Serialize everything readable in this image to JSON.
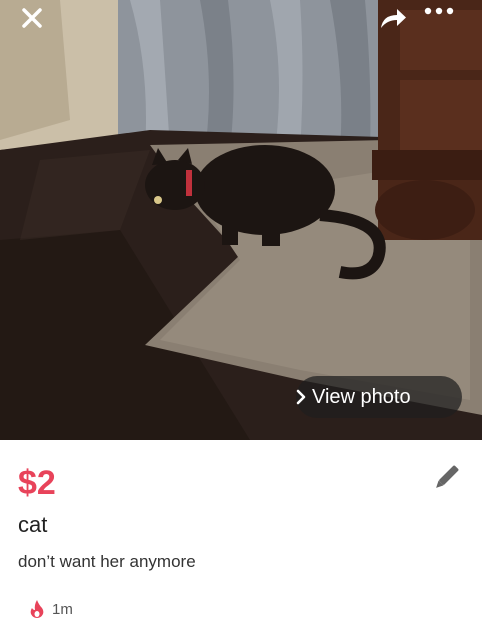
{
  "header": {
    "close_icon": "close-icon",
    "share_icon": "share-icon",
    "more_icon": "more-dots-icon"
  },
  "photo": {
    "view_photo_label": "View photo",
    "view_photo_icon": "chevron-right-icon"
  },
  "listing": {
    "price": "$2",
    "title": "cat",
    "description": "don’t want her anymore",
    "age": "1m",
    "age_icon": "flame-icon",
    "edit_icon": "pencil-icon"
  },
  "colors": {
    "price": "#e8435a",
    "flame": "#e8435a",
    "icon_gray": "#666666"
  }
}
